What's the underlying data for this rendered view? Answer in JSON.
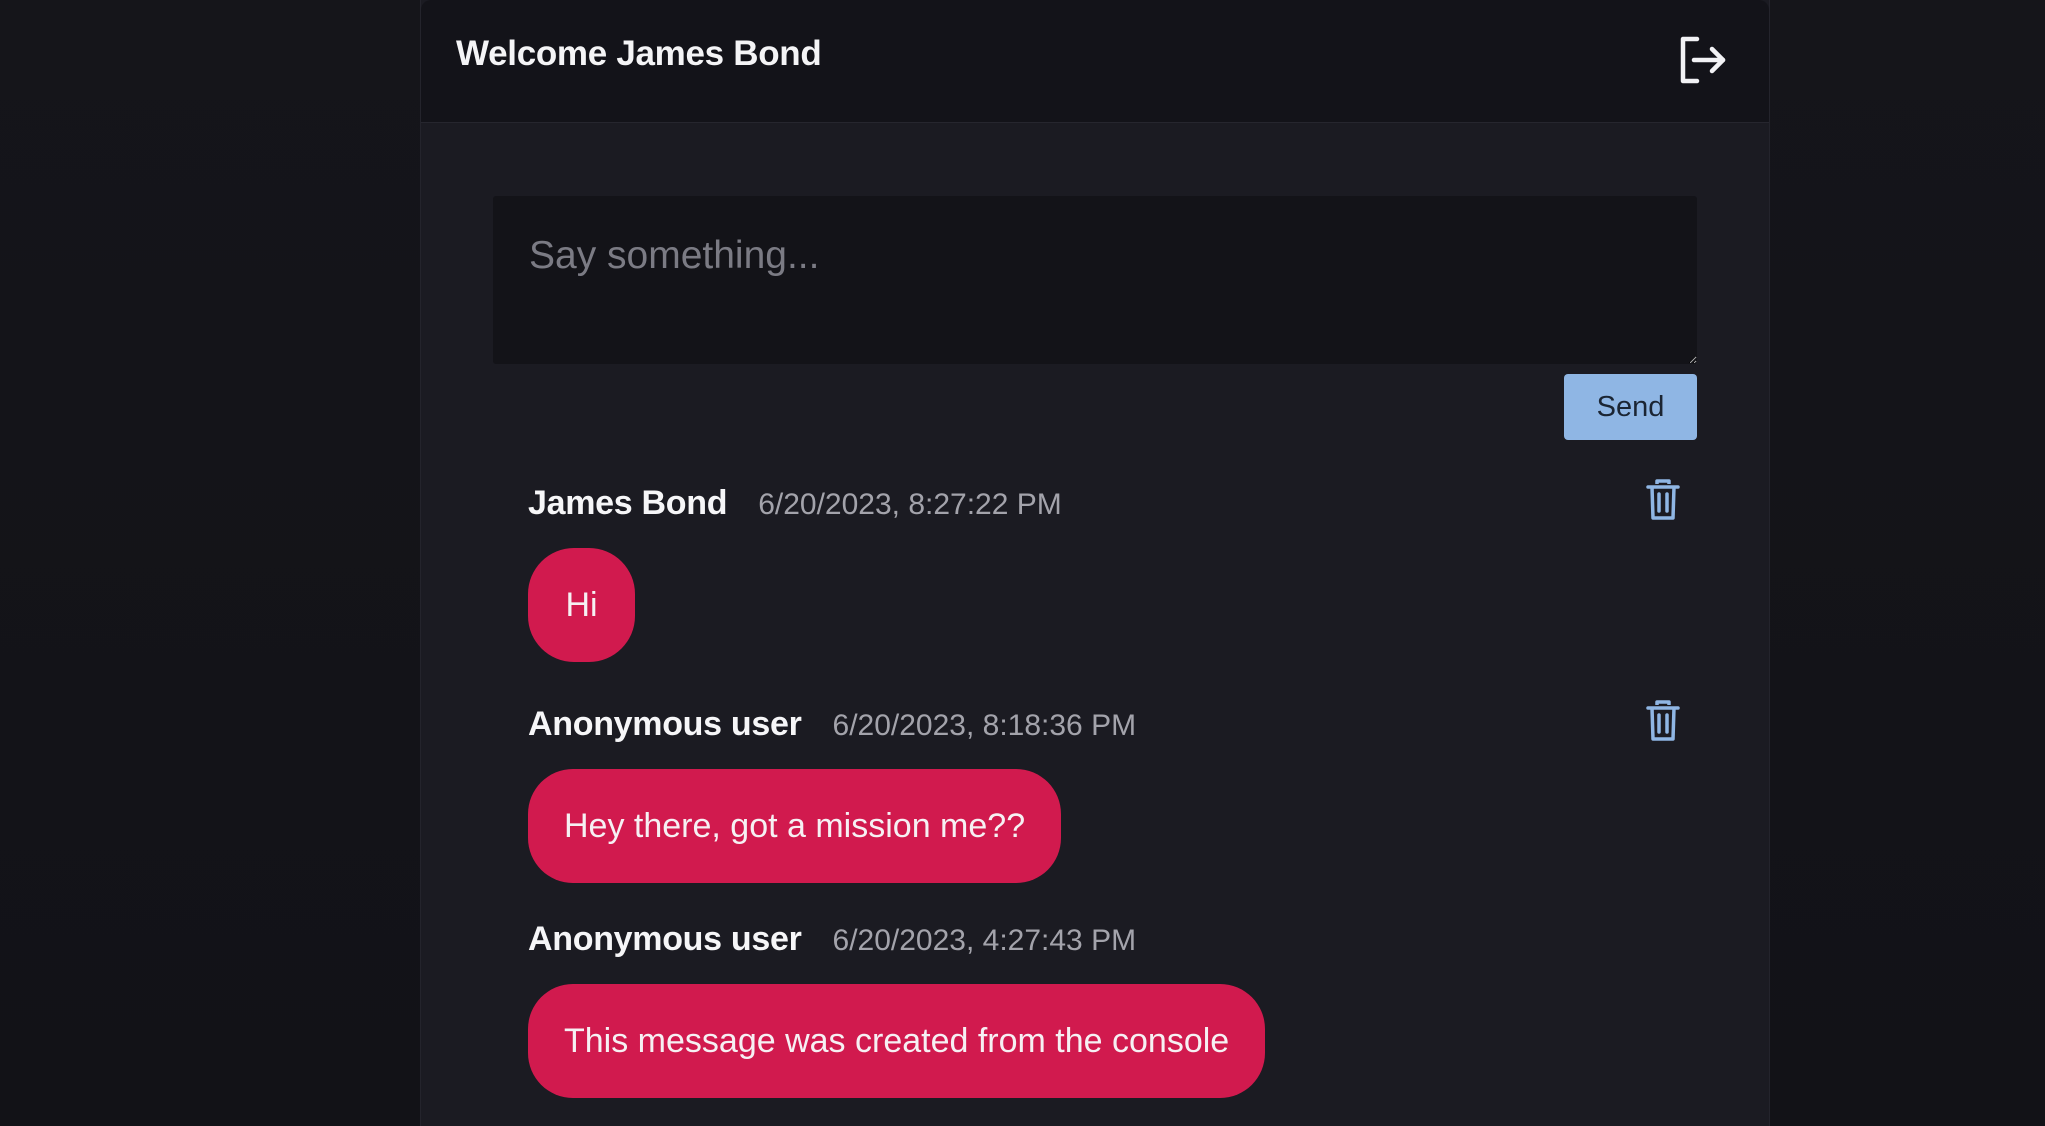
{
  "header": {
    "welcome": "Welcome James Bond",
    "logout_icon": "logout-icon"
  },
  "composer": {
    "placeholder": "Say something...",
    "value": "",
    "send_label": "Send"
  },
  "messages": [
    {
      "author": "James Bond",
      "timestamp": "6/20/2023, 8:27:22 PM",
      "text": "Hi",
      "deletable": true
    },
    {
      "author": "Anonymous user",
      "timestamp": "6/20/2023, 8:18:36 PM",
      "text": "Hey there, got a mission me??",
      "deletable": true
    },
    {
      "author": "Anonymous user",
      "timestamp": "6/20/2023, 4:27:43 PM",
      "text": "This message was created from the console",
      "deletable": false
    }
  ],
  "colors": {
    "background": "#141419",
    "panel": "#1b1b22",
    "header": "#131319",
    "bubble": "#d11a4e",
    "send_button": "#8fb6e4",
    "trash_icon": "#8fb6e4"
  }
}
